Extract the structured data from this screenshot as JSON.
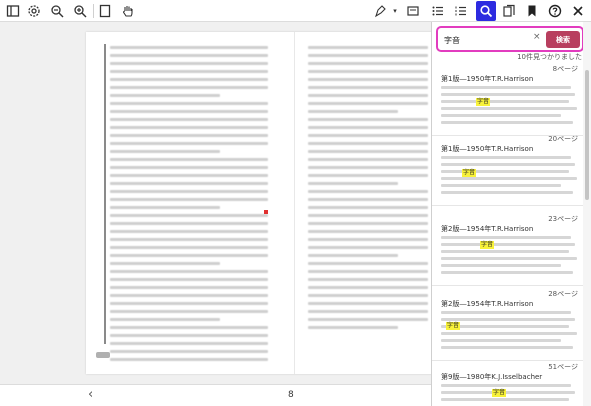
{
  "toolbar": {
    "icons": [
      "gear-icon",
      "zoom-out-icon",
      "zoom-in-icon",
      "page-layout-icon",
      "hand-tool-icon",
      "pen-tool-icon",
      "chevron-down-icon",
      "note-icon",
      "list-icon",
      "numbered-list-icon",
      "search-icon",
      "bookmarks-icon",
      "bookmark-icon",
      "help-icon",
      "close-icon"
    ]
  },
  "document": {
    "page_number": "8",
    "prev_label": "‹"
  },
  "search": {
    "query": "字音",
    "clear": "×",
    "button_label": "検索",
    "found_text": "10件見つかりました",
    "results": [
      {
        "page": "8ページ",
        "title": "第1版―1950年T.R.Harrison",
        "hit": "字音"
      },
      {
        "page": "20ページ",
        "title": "第1版―1950年T.R.Harrison",
        "hit": "字音"
      },
      {
        "page": "23ページ",
        "title": "第2版―1954年T.R.Harrison",
        "hit": "字音"
      },
      {
        "page": "28ページ",
        "title": "第2版―1954年T.R.Harrison",
        "hit": "字音"
      },
      {
        "page": "51ページ",
        "title": "第9版―1980年K.J.Isselbacher",
        "hit": "字音"
      }
    ]
  }
}
